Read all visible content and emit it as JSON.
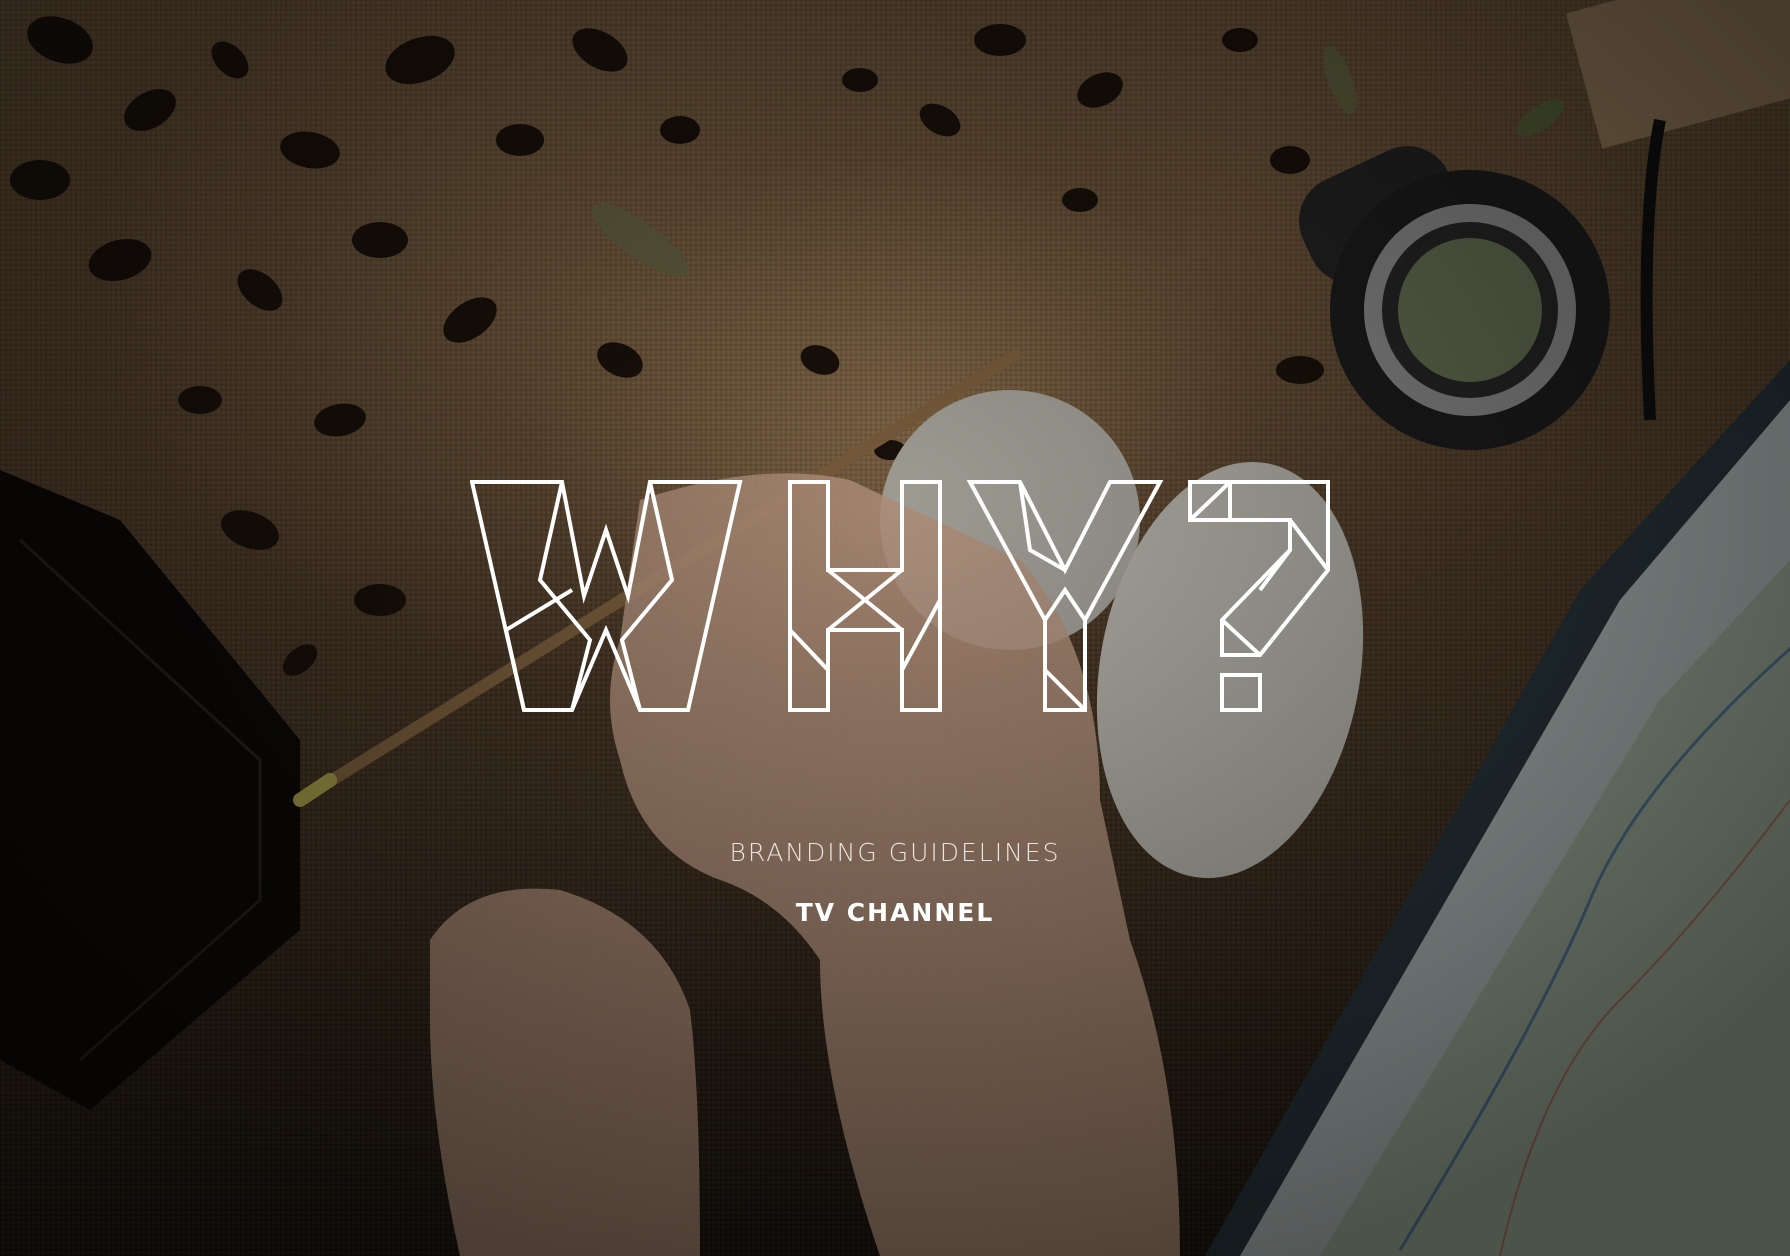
{
  "cover": {
    "logo_text": "WHY?",
    "subtitle": "BRANDING GUIDELINES",
    "tagline": "TV CHANNEL"
  },
  "colors": {
    "text": "#ffffff",
    "burlap": "#8a6c4a",
    "overlay": "#000000"
  },
  "background_objects": [
    "tea-leaves",
    "compass-device",
    "map-tablet",
    "leather-wallet",
    "pencil",
    "white-stones",
    "hands"
  ]
}
